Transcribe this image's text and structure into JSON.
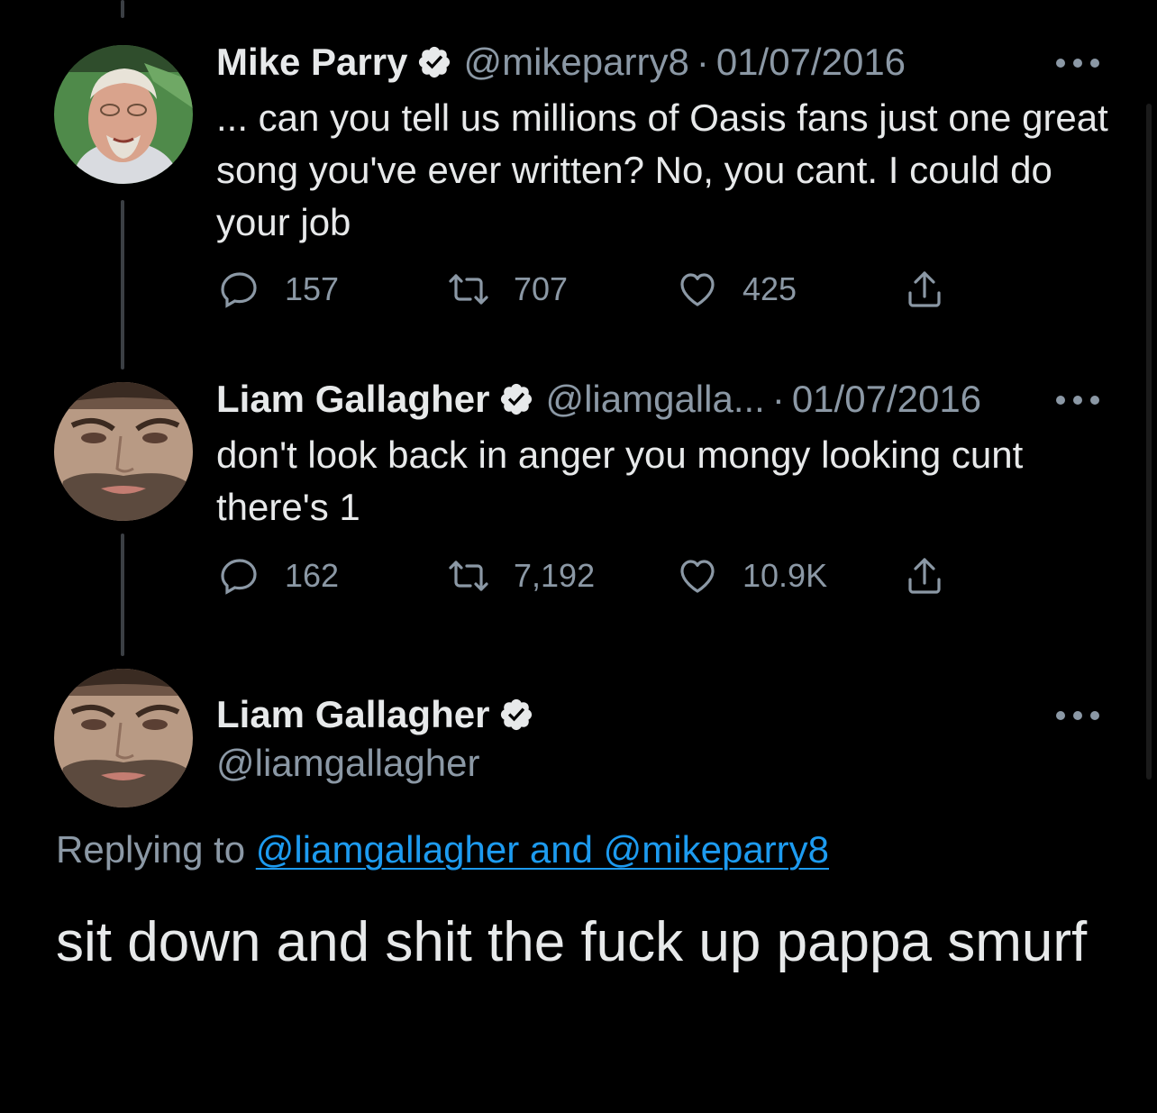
{
  "colors": {
    "background": "#000000",
    "text": "#e7e9ea",
    "muted": "#8b98a5",
    "link": "#1d9bf0",
    "verified": "#e7e9ea"
  },
  "tweets": [
    {
      "name": "Mike Parry",
      "handle": "@mikeparry8",
      "separator": "·",
      "date": "01/07/2016",
      "text": "... can you tell us millions of Oasis fans just one great song you've ever written? No, you cant. I could do your job",
      "replies": "157",
      "retweets": "707",
      "likes": "425",
      "avatar_icon": "avatar-mike-parry"
    },
    {
      "name": "Liam Gallagher",
      "handle": "@liamgalla...",
      "separator": "·",
      "date": "01/07/2016",
      "text": "don't look back in anger you mongy looking cunt there's 1",
      "replies": "162",
      "retweets": "7,192",
      "likes": "10.9K",
      "avatar_icon": "avatar-liam-gallagher"
    }
  ],
  "main_tweet": {
    "name": "Liam Gallagher",
    "handle": "@liamgallagher",
    "replying_prefix": "Replying to ",
    "replying_to": "@liamgallagher and @mikeparry8",
    "text": "sit down and shit the fuck up pappa smurf",
    "avatar_icon": "avatar-liam-gallagher"
  }
}
